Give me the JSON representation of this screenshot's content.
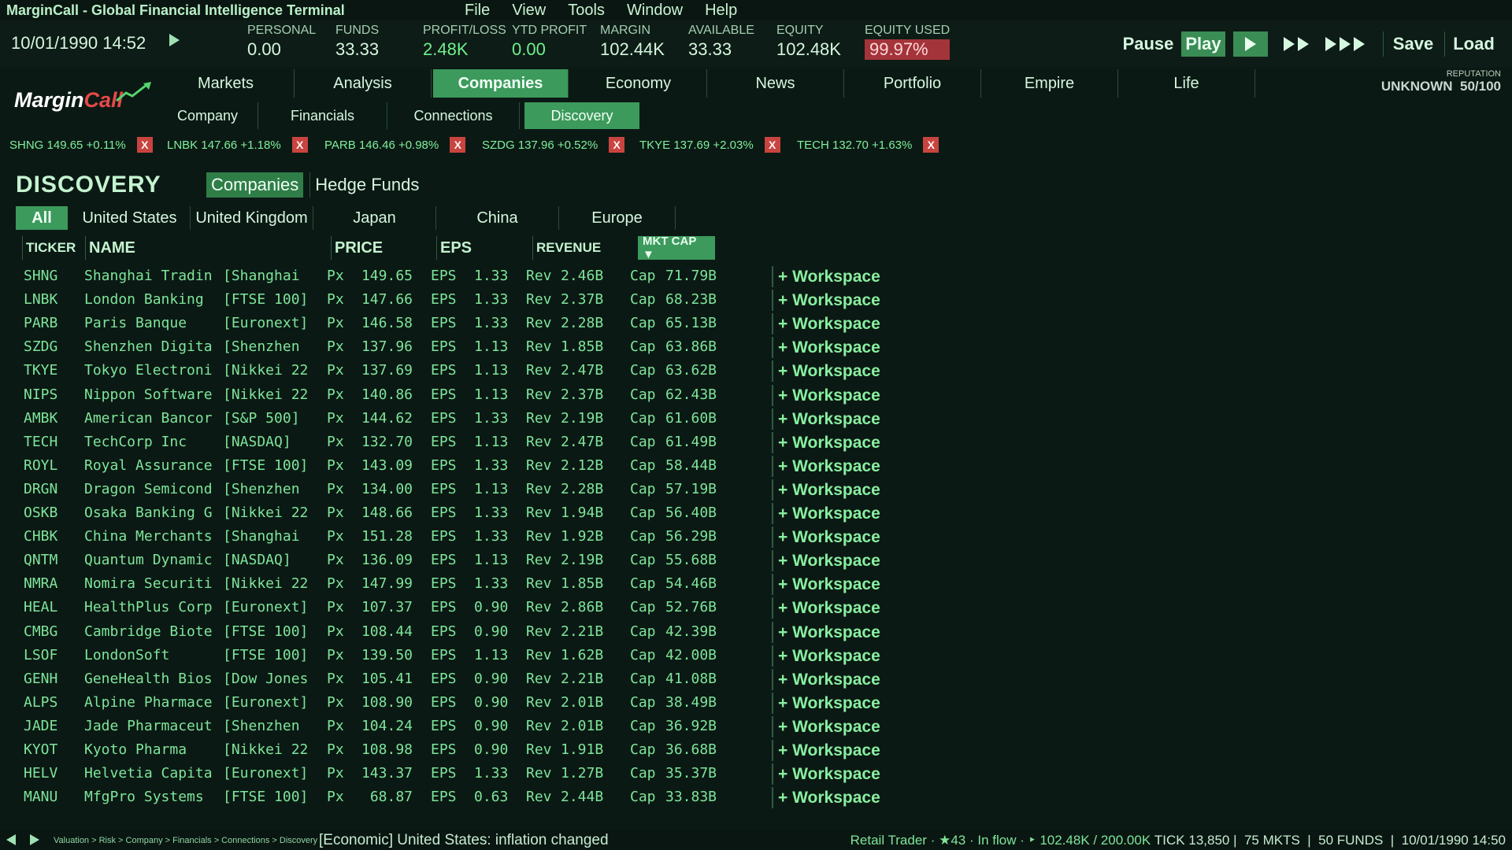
{
  "app": {
    "title": "MarginCall - Global Financial Intelligence Terminal",
    "menu": [
      "File",
      "View",
      "Tools",
      "Window",
      "Help"
    ]
  },
  "status": {
    "datetime": "10/01/1990 14:52",
    "personal_label": "PERSONAL",
    "personal": "0.00",
    "funds_label": "FUNDS",
    "funds": "33.33",
    "pl_label": "PROFIT/LOSS",
    "pl": "2.48K",
    "ytd_label": "YTD PROFIT",
    "ytd": "0.00",
    "margin_label": "MARGIN",
    "margin": "102.44K",
    "available_label": "AVAILABLE",
    "available": "33.33",
    "equity_label": "EQUITY",
    "equity": "102.48K",
    "equity_used_label": "EQUITY USED",
    "equity_used": "99.97%"
  },
  "controls": {
    "pause": "Pause",
    "play": "Play",
    "save": "Save",
    "load": "Load"
  },
  "logo": {
    "part1": "Margin",
    "part2": "Call"
  },
  "nav": {
    "main_tabs": [
      "Markets",
      "Analysis",
      "Companies",
      "Economy",
      "News",
      "Portfolio",
      "Empire",
      "Life"
    ],
    "sub_tabs": [
      "Company",
      "Financials",
      "Connections",
      "Discovery"
    ]
  },
  "reputation": {
    "label": "REPUTATION",
    "status": "UNKNOWN",
    "score": "50/100"
  },
  "ticker": [
    {
      "text": "SHNG 149.65 +0.11%"
    },
    {
      "text": "LNBK 147.66 +1.18%"
    },
    {
      "text": "PARB 146.46 +0.98%"
    },
    {
      "text": "SZDG 137.96 +0.52%"
    },
    {
      "text": "TKYE 137.69 +2.03%"
    },
    {
      "text": "TECH 132.70 +1.63%"
    }
  ],
  "ticker_remove": "X",
  "discovery": {
    "title": "DISCOVERY",
    "views": [
      "Companies",
      "Hedge Funds"
    ],
    "regions": [
      "All",
      "United States",
      "United Kingdom",
      "Japan",
      "China",
      "Europe"
    ],
    "headers": {
      "ticker": "TICKER",
      "name": "NAME",
      "price": "PRICE",
      "eps": "EPS",
      "revenue": "REVENUE",
      "mktcap": "MKT CAP ▼"
    },
    "labels": {
      "px": "Px",
      "eps": "EPS",
      "rev": "Rev",
      "cap": "Cap",
      "workspace": "+ Workspace"
    },
    "rows": [
      {
        "ticker": "SHNG",
        "name": "Shanghai Tradin",
        "exch": "[Shanghai",
        "price": "149.65",
        "eps": "1.33",
        "rev": "2.46B",
        "cap": "71.79B"
      },
      {
        "ticker": "LNBK",
        "name": "London Banking",
        "exch": "[FTSE 100]",
        "price": "147.66",
        "eps": "1.33",
        "rev": "2.37B",
        "cap": "68.23B"
      },
      {
        "ticker": "PARB",
        "name": "Paris Banque",
        "exch": "[Euronext]",
        "price": "146.58",
        "eps": "1.33",
        "rev": "2.28B",
        "cap": "65.13B"
      },
      {
        "ticker": "SZDG",
        "name": "Shenzhen Digita",
        "exch": "[Shenzhen",
        "price": "137.96",
        "eps": "1.13",
        "rev": "1.85B",
        "cap": "63.86B"
      },
      {
        "ticker": "TKYE",
        "name": "Tokyo Electroni",
        "exch": "[Nikkei 22",
        "price": "137.69",
        "eps": "1.13",
        "rev": "2.47B",
        "cap": "63.62B"
      },
      {
        "ticker": "NIPS",
        "name": "Nippon Software",
        "exch": "[Nikkei 22",
        "price": "140.86",
        "eps": "1.13",
        "rev": "2.37B",
        "cap": "62.43B"
      },
      {
        "ticker": "AMBK",
        "name": "American Bancor",
        "exch": "[S&P 500]",
        "price": "144.62",
        "eps": "1.33",
        "rev": "2.19B",
        "cap": "61.60B"
      },
      {
        "ticker": "TECH",
        "name": "TechCorp Inc",
        "exch": "[NASDAQ]",
        "price": "132.70",
        "eps": "1.13",
        "rev": "2.47B",
        "cap": "61.49B"
      },
      {
        "ticker": "ROYL",
        "name": "Royal Assurance",
        "exch": "[FTSE 100]",
        "price": "143.09",
        "eps": "1.33",
        "rev": "2.12B",
        "cap": "58.44B"
      },
      {
        "ticker": "DRGN",
        "name": "Dragon Semicond",
        "exch": "[Shenzhen",
        "price": "134.00",
        "eps": "1.13",
        "rev": "2.28B",
        "cap": "57.19B"
      },
      {
        "ticker": "OSKB",
        "name": "Osaka Banking G",
        "exch": "[Nikkei 22",
        "price": "148.66",
        "eps": "1.33",
        "rev": "1.94B",
        "cap": "56.40B"
      },
      {
        "ticker": "CHBK",
        "name": "China Merchants",
        "exch": "[Shanghai",
        "price": "151.28",
        "eps": "1.33",
        "rev": "1.92B",
        "cap": "56.29B"
      },
      {
        "ticker": "QNTM",
        "name": "Quantum Dynamic",
        "exch": "[NASDAQ]",
        "price": "136.09",
        "eps": "1.13",
        "rev": "2.19B",
        "cap": "55.68B"
      },
      {
        "ticker": "NMRA",
        "name": "Nomira Securiti",
        "exch": "[Nikkei 22",
        "price": "147.99",
        "eps": "1.33",
        "rev": "1.85B",
        "cap": "54.46B"
      },
      {
        "ticker": "HEAL",
        "name": "HealthPlus Corp",
        "exch": "[Euronext]",
        "price": "107.37",
        "eps": "0.90",
        "rev": "2.86B",
        "cap": "52.76B"
      },
      {
        "ticker": "CMBG",
        "name": "Cambridge Biote",
        "exch": "[FTSE 100]",
        "price": "108.44",
        "eps": "0.90",
        "rev": "2.21B",
        "cap": "42.39B"
      },
      {
        "ticker": "LSOF",
        "name": "LondonSoft",
        "exch": "[FTSE 100]",
        "price": "139.50",
        "eps": "1.13",
        "rev": "1.62B",
        "cap": "42.00B"
      },
      {
        "ticker": "GENH",
        "name": "GeneHealth Bios",
        "exch": "[Dow Jones",
        "price": "105.41",
        "eps": "0.90",
        "rev": "2.21B",
        "cap": "41.08B"
      },
      {
        "ticker": "ALPS",
        "name": "Alpine Pharmace",
        "exch": "[Euronext]",
        "price": "108.90",
        "eps": "0.90",
        "rev": "2.01B",
        "cap": "38.49B"
      },
      {
        "ticker": "JADE",
        "name": "Jade Pharmaceut",
        "exch": "[Shenzhen",
        "price": "104.24",
        "eps": "0.90",
        "rev": "2.01B",
        "cap": "36.92B"
      },
      {
        "ticker": "KYOT",
        "name": "Kyoto Pharma",
        "exch": "[Nikkei 22",
        "price": "108.98",
        "eps": "0.90",
        "rev": "1.91B",
        "cap": "36.68B"
      },
      {
        "ticker": "HELV",
        "name": "Helvetia Capita",
        "exch": "[Euronext]",
        "price": "143.37",
        "eps": "1.33",
        "rev": "1.27B",
        "cap": "35.37B"
      },
      {
        "ticker": "MANU",
        "name": "MfgPro Systems",
        "exch": "[FTSE 100]",
        "price": "68.87",
        "eps": "0.63",
        "rev": "2.44B",
        "cap": "33.83B"
      }
    ]
  },
  "footer": {
    "breadcrumb": "Valuation > Risk > Company > Financials > Connections > Discovery",
    "news": "[Economic] United States: inflation changed",
    "role": "Retail Trader",
    "stars": "★43",
    "flow": "In flow",
    "capital": "‣ 102.48K / 200.00K",
    "tick": "TICK 13,850",
    "markets": "75 MKTS",
    "funds": "50 FUNDS",
    "datetime": "10/01/1990 14:50"
  },
  "colors": {
    "background": "#0b1914",
    "accent": "#3c9a5c",
    "text_green": "#7ee59a",
    "alert": "#a3343a",
    "remove": "#c8443f"
  }
}
